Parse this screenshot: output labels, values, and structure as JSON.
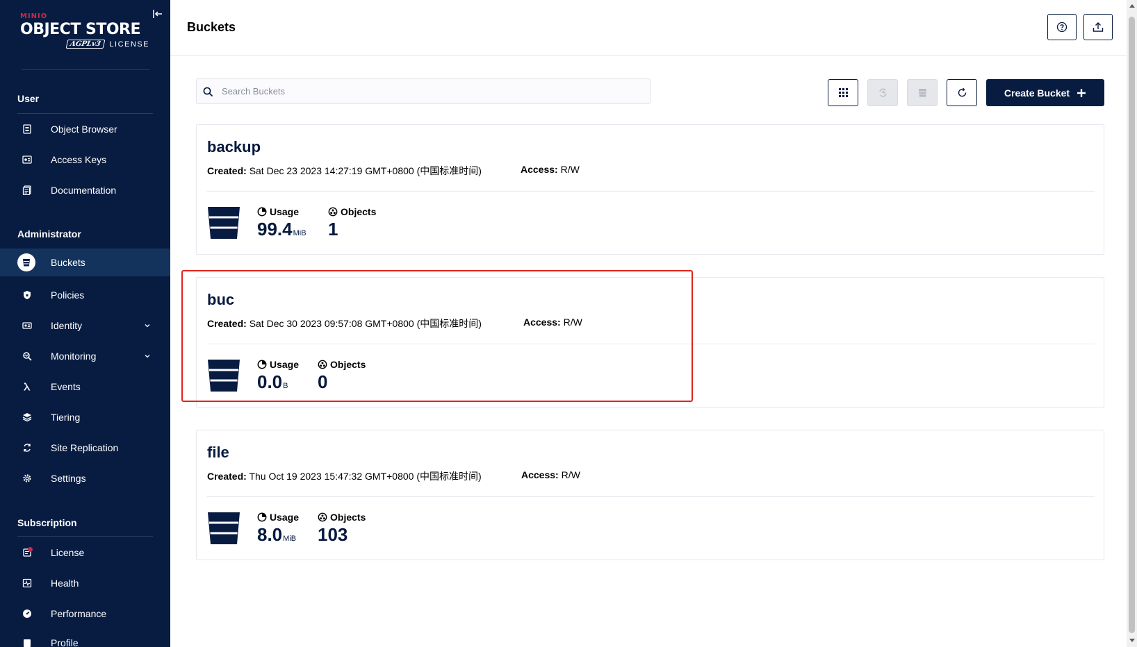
{
  "brand": {
    "small": "MINIO",
    "main": "OBJECT STORE",
    "agpl": "AGPLv3",
    "license": "LICENSE"
  },
  "sidebar": {
    "sections": {
      "user": "User",
      "administrator": "Administrator",
      "subscription": "Subscription"
    },
    "items": [
      {
        "label": "Object Browser",
        "icon": "object-browser-icon"
      },
      {
        "label": "Access Keys",
        "icon": "access-keys-icon"
      },
      {
        "label": "Documentation",
        "icon": "documentation-icon"
      },
      {
        "label": "Buckets",
        "icon": "buckets-icon",
        "active": true
      },
      {
        "label": "Policies",
        "icon": "policies-icon"
      },
      {
        "label": "Identity",
        "icon": "identity-icon",
        "expandable": true
      },
      {
        "label": "Monitoring",
        "icon": "monitoring-icon",
        "expandable": true
      },
      {
        "label": "Events",
        "icon": "lambda-icon"
      },
      {
        "label": "Tiering",
        "icon": "tiering-icon"
      },
      {
        "label": "Site Replication",
        "icon": "site-replication-icon"
      },
      {
        "label": "Settings",
        "icon": "settings-icon"
      },
      {
        "label": "License",
        "icon": "license-icon",
        "badge": true
      },
      {
        "label": "Health",
        "icon": "health-icon"
      },
      {
        "label": "Performance",
        "icon": "performance-icon"
      },
      {
        "label": "Profile",
        "icon": "profile-icon"
      }
    ]
  },
  "header": {
    "title": "Buckets",
    "help_icon": "help-icon",
    "upload_icon": "upload-icon"
  },
  "toolbar": {
    "search_placeholder": "Search Buckets",
    "search_value": "",
    "create_label": "Create Bucket",
    "buttons": [
      "grid-view-icon",
      "replication-icon",
      "lifecycle-icon",
      "refresh-icon"
    ]
  },
  "buckets": [
    {
      "name": "backup",
      "created_label": "Created:",
      "created": "Sat Dec 23 2023 14:27:19 GMT+0800 (中国标准时间)",
      "access_label": "Access:",
      "access": "R/W",
      "usage_label": "Usage",
      "usage_value": "99.4",
      "usage_unit": "MiB",
      "objects_label": "Objects",
      "objects_value": "1"
    },
    {
      "name": "buc",
      "created_label": "Created:",
      "created": "Sat Dec 30 2023 09:57:08 GMT+0800 (中国标准时间)",
      "access_label": "Access:",
      "access": "R/W",
      "usage_label": "Usage",
      "usage_value": "0.0",
      "usage_unit": "B",
      "objects_label": "Objects",
      "objects_value": "0",
      "highlighted": true
    },
    {
      "name": "file",
      "created_label": "Created:",
      "created": "Thu Oct 19 2023 15:47:32 GMT+0800 (中国标准时间)",
      "access_label": "Access:",
      "access": "R/W",
      "usage_label": "Usage",
      "usage_value": "8.0",
      "usage_unit": "MiB",
      "objects_label": "Objects",
      "objects_value": "103"
    }
  ],
  "colors": {
    "sidebar_bg": "#081c42",
    "active_bg": "#14335c",
    "accent_red": "#c72c48",
    "highlight_border": "#e2231a",
    "primary_button": "#081c42"
  }
}
